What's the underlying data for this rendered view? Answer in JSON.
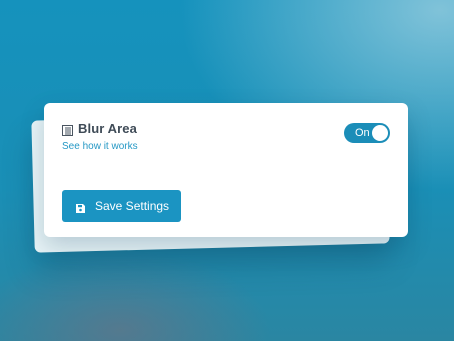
{
  "card": {
    "title": "Blur Area",
    "title_icon": "blur-area-icon",
    "help_link": "See how it works"
  },
  "toggle": {
    "label": "On",
    "state": true,
    "color": "#1b8db8"
  },
  "save_button": {
    "label": "Save Settings",
    "icon": "save-icon",
    "color": "#1b94c2"
  },
  "colors": {
    "accent": "#1b94c2",
    "link": "#2598c5",
    "title": "#3f4b57"
  }
}
